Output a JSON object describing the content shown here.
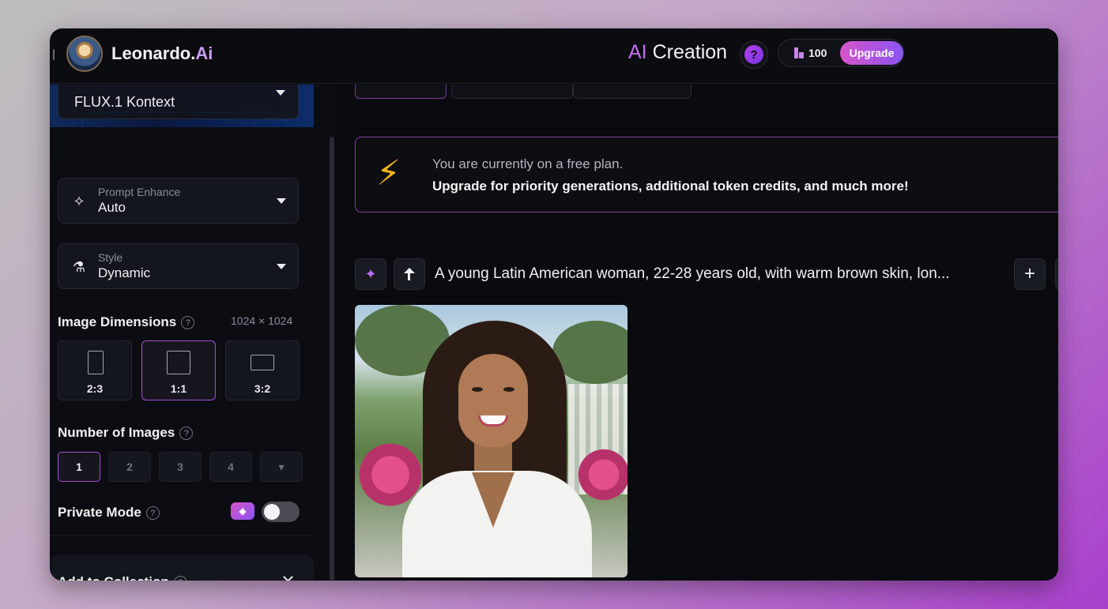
{
  "app": {
    "logo_name": "Leonardo.",
    "logo_ai": "Ai"
  },
  "header": {
    "title_ai": "AI",
    "title_rest": " Creation",
    "help_symbol": "?",
    "token_count": "100",
    "upgrade_label": "Upgrade"
  },
  "sidebar": {
    "model_label": "FLUX.1 Kontext",
    "prompt_enhance": {
      "label": "Prompt Enhance",
      "value": "Auto",
      "icon": "sparkle-icon"
    },
    "style": {
      "label": "Style",
      "value": "Dynamic",
      "icon": "flask-icon"
    },
    "image_dimensions": {
      "title": "Image Dimensions",
      "value": "1024 × 1024",
      "ratios": [
        {
          "label": "2:3",
          "selected": false
        },
        {
          "label": "1:1",
          "selected": true
        },
        {
          "label": "3:2",
          "selected": false
        }
      ]
    },
    "number_of_images": {
      "title": "Number of Images",
      "options": [
        "1",
        "2",
        "3",
        "4",
        "▾"
      ],
      "selected": "1"
    },
    "private_mode": {
      "title": "Private Mode",
      "enabled": false
    },
    "collection": {
      "title": "Add to Collection"
    }
  },
  "main": {
    "banner": {
      "line1": "You are currently on a free plan.",
      "line2": "Upgrade for priority generations, additional token credits, and much more!"
    },
    "prompt": {
      "text": "A young Latin American woman, 22-28 years old, with warm brown skin, lon...",
      "add_symbol": "+"
    }
  },
  "colors": {
    "accent_purple": "#a14fd6",
    "upgrade_gradient_start": "#d655c9",
    "upgrade_gradient_end": "#8a54f0",
    "bolt_yellow": "#f7b31c"
  }
}
